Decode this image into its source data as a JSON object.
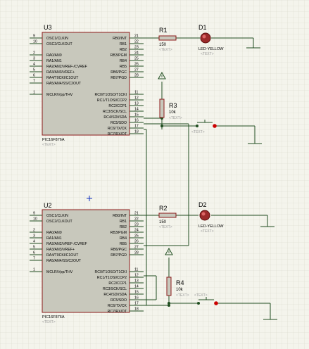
{
  "schematic": {
    "u3": {
      "ref": "U3",
      "part": "PIC16F876A",
      "text_placeholder": "<TEXT>",
      "left_pin_numbers": [
        "9",
        "10",
        "2",
        "3",
        "4",
        "5",
        "6",
        "7",
        "1"
      ],
      "left_pin_labels": [
        "OSC1/CLKIN",
        "OSC2/CLKOUT",
        "RA0/AN0",
        "RA1/AN1",
        "RA2/AN2/VREF-/CVREF",
        "RA3/AN3/VREF+",
        "RA4/T0CKI/C1OUT",
        "RA5/AN4/SS/C2OUT",
        "MCLR/Vpp/THV"
      ],
      "right_pin_numbers": [
        "21",
        "22",
        "23",
        "24",
        "25",
        "26",
        "27",
        "28",
        "11",
        "12",
        "13",
        "14",
        "15",
        "16",
        "17",
        "18"
      ],
      "right_pin_labels": [
        "RB0/INT",
        "RB1",
        "RB2",
        "RB3/PGM",
        "RB4",
        "RB5",
        "RB6/PGC",
        "RB7/PGD",
        "RC0/T1OSO/T1CKI",
        "RC1/T1OSI/CCP2",
        "RC2/CCP1",
        "RC3/SCK/SCL",
        "RC4/SDI/SDA",
        "RC5/SDO",
        "RC6/TX/CK",
        "RC7/RX/DT"
      ]
    },
    "u2": {
      "ref": "U2",
      "part": "PIC16F876A",
      "text_placeholder": "<TEXT>",
      "left_pin_numbers": [
        "9",
        "10",
        "2",
        "3",
        "4",
        "5",
        "6",
        "7",
        "1"
      ],
      "left_pin_labels": [
        "OSC1/CLKIN",
        "OSC2/CLKOUT",
        "RA0/AN0",
        "RA1/AN1",
        "RA2/AN2/VREF-/CVREF",
        "RA3/AN3/VREF+",
        "RA4/T0CKI/C1OUT",
        "RA5/AN4/SS/C2OUT",
        "MCLR/Vpp/THV"
      ],
      "right_pin_numbers": [
        "21",
        "22",
        "23",
        "24",
        "25",
        "26",
        "27",
        "28",
        "11",
        "12",
        "13",
        "14",
        "15",
        "16",
        "17",
        "18"
      ],
      "right_pin_labels": [
        "RB0/INT",
        "RB1",
        "RB2",
        "RB3/PGM",
        "RB4",
        "RB5",
        "RB6/PGC",
        "RB7/PGD",
        "RC0/T1OSO/T1CKI",
        "RC1/T1OSI/CCP2",
        "RC2/CCP1",
        "RC3/SCK/SCL",
        "RC4/SDI/SDA",
        "RC5/SDO",
        "RC6/TX/CK",
        "RC7/RX/DT"
      ]
    },
    "r1": {
      "ref": "R1",
      "value": "150",
      "text_placeholder": "<TEXT>"
    },
    "r2": {
      "ref": "R2",
      "value": "150",
      "text_placeholder": "<TEXT>"
    },
    "r3": {
      "ref": "R3",
      "value": "10k",
      "text_placeholder": "<TEXT>"
    },
    "r4": {
      "ref": "R4",
      "value": "10k",
      "text_placeholder": "<TEXT>"
    },
    "d1": {
      "ref": "D1",
      "value": "LED-YELLOW",
      "text_placeholder": "<TEXT>"
    },
    "d2": {
      "ref": "D2",
      "value": "LED-YELLOW",
      "text_placeholder": "<TEXT>"
    },
    "sw1": {
      "text_placeholder": "<TEXT>"
    },
    "sw2": {
      "text_placeholder": "<TEXT>"
    }
  },
  "colors": {
    "background": "#f4f4ec",
    "grid": "#d8d8cc",
    "component_outline": "#8b1a1a",
    "ic_fill": "#c8c8bc",
    "resistor_fill": "#c8c8bc",
    "wire": "#1f4d1f",
    "text": "#000000",
    "placeholder_text": "#9a9a9a",
    "led": "#8b1a1a",
    "junction": "#1f4d1f",
    "switch_contact": "#cc0000",
    "cursor": "#1030c0"
  }
}
